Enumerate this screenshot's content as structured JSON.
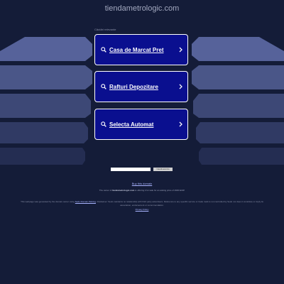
{
  "header": {
    "domain": "tiendametrologic.com",
    "related_label": "Căutări relevante"
  },
  "links": [
    {
      "label": "Casa de Marcat Pret"
    },
    {
      "label": "Rafturi Depozitare"
    },
    {
      "label": "Selecta Automat"
    }
  ],
  "search": {
    "placeholder": "",
    "button_label": "Caută acordu"
  },
  "footer": {
    "buy_link": "Buy this domain",
    "owner_prefix": "The owner of ",
    "owner_domain": "tiendametrologic.com",
    "owner_suffix": " is offering it for sale for an asking price of 2900 EUR!",
    "disclaimer_prefix": "This webpage was generated by the domain owner using ",
    "disclaimer_link": "Sedo Domain Parking",
    "disclaimer_suffix": ". Disclaimer: Sedo maintains no relationship with third party advertisers. Reference to any specific service or trade mark is not controlled by Sedo nor does it constitute or imply its association, endorsement or recommendation.",
    "privacy": "Privacy Policy"
  },
  "colors": {
    "background": "#141c38",
    "link_box": "#0a0f8f",
    "band": "#4d5b8c"
  }
}
